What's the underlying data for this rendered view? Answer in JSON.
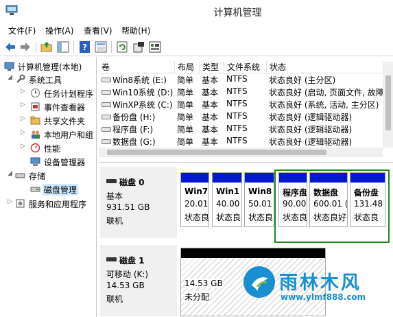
{
  "window": {
    "title": "计算机管理"
  },
  "menu": [
    {
      "label": "文件(F)"
    },
    {
      "label": "操作(A)"
    },
    {
      "label": "查看(V)"
    },
    {
      "label": "帮助(H)"
    }
  ],
  "toolbar": {
    "icons": [
      "back-icon",
      "forward-icon",
      "up-folder-icon",
      "show-hide-tree-icon",
      "help-icon",
      "properties-icon",
      "refresh-icon",
      "settings-icon",
      "export-list-icon"
    ]
  },
  "tree": {
    "root": "计算机管理(本地)",
    "system_tools": "系统工具",
    "task_scheduler": "任务计划程序",
    "event_viewer": "事件查看器",
    "shared_folders": "共享文件夹",
    "local_users": "本地用户和组",
    "performance": "性能",
    "device_manager": "设备管理器",
    "storage": "存储",
    "disk_management": "磁盘管理",
    "services_apps": "服务和应用程序"
  },
  "volume_list": {
    "columns": [
      "卷",
      "布局",
      "类型",
      "文件系统",
      "状态"
    ],
    "rows": [
      {
        "volume": "Win8系统 (E:)",
        "layout": "简单",
        "type": "基本",
        "fs": "NTFS",
        "status": "状态良好 (主分区)"
      },
      {
        "volume": "Win10系统 (D:)",
        "layout": "简单",
        "type": "基本",
        "fs": "NTFS",
        "status": "状态良好 (启动, 页面文件, 故障"
      },
      {
        "volume": "WinXP系统 (C:)",
        "layout": "简单",
        "type": "基本",
        "fs": "NTFS",
        "status": "状态良好 (系统, 活动, 主分区)"
      },
      {
        "volume": "备份盘 (H:)",
        "layout": "简单",
        "type": "基本",
        "fs": "NTFS",
        "status": "状态良好 (逻辑驱动器)"
      },
      {
        "volume": "程序盘 (F:)",
        "layout": "简单",
        "type": "基本",
        "fs": "NTFS",
        "status": "状态良好 (逻辑驱动器)"
      },
      {
        "volume": "数据盘 (G:)",
        "layout": "简单",
        "type": "基本",
        "fs": "NTFS",
        "status": "状态良好 (逻辑驱动器)"
      }
    ]
  },
  "disks": [
    {
      "name": "磁盘 0",
      "type": "基本",
      "size": "931.51 GB",
      "state": "联机",
      "partitions": [
        {
          "name": "Win7",
          "size": "20.01",
          "status": "状态良"
        },
        {
          "name": "Win1",
          "size": "40.00",
          "status": "状态良"
        },
        {
          "name": "Win8",
          "size": "50.01",
          "status": "状态良"
        },
        {
          "name": "程序盘",
          "size": "90.00",
          "status": "状态良"
        },
        {
          "name": "数据盘",
          "size": "600.01 (",
          "status": "状态良好"
        },
        {
          "name": "备份盘",
          "size": "131.48",
          "status": "状态良"
        }
      ]
    },
    {
      "name": "磁盘 1",
      "type": "可移动 (K:)",
      "size": "14.53 GB",
      "state": "联机",
      "unallocated": {
        "size": "14.53 GB",
        "label": "未分配"
      }
    }
  ],
  "watermark": {
    "name": "雨林木风",
    "url": "www.ylmf888.com"
  },
  "colors": {
    "primary_bar": "#0018d0",
    "extended_border": "#1d8a1d",
    "selection": "#cde8ff",
    "watermark": "#1a8fd0"
  }
}
